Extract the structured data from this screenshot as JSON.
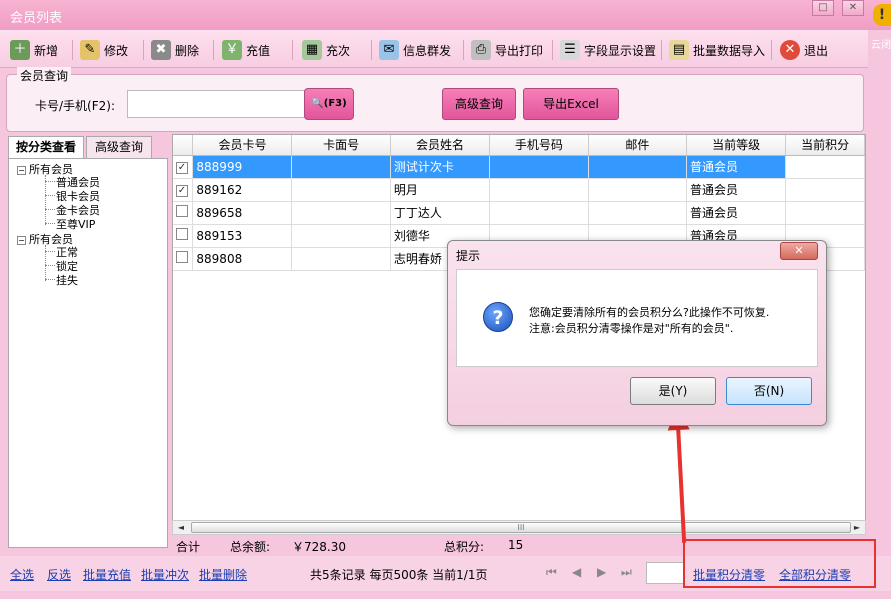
{
  "window": {
    "title": "会员列表",
    "min_glyph": "□",
    "close_glyph": "✕",
    "side_warn": "!",
    "side_text": "云闭"
  },
  "toolbar": [
    {
      "label": "新增",
      "icon": "add-member-icon"
    },
    {
      "label": "修改",
      "icon": "edit-icon"
    },
    {
      "label": "删除",
      "icon": "delete-icon"
    },
    {
      "label": "充值",
      "icon": "recharge-icon"
    },
    {
      "label": "充次",
      "icon": "recharge-count-icon"
    },
    {
      "label": "信息群发",
      "icon": "message-icon"
    },
    {
      "label": "导出打印",
      "icon": "printer-icon"
    },
    {
      "label": "字段显示设置",
      "icon": "field-settings-icon"
    },
    {
      "label": "批量数据导入",
      "icon": "import-icon"
    },
    {
      "label": "退出",
      "icon": "exit-icon"
    }
  ],
  "query": {
    "legend": "会员查询",
    "card_label": "卡号/手机(F2):",
    "card_value": "",
    "f3_label": "(F3)",
    "advanced_label": "高级查询",
    "export_label": "导出Excel"
  },
  "left_tabs": [
    "按分类查看",
    "高级查询"
  ],
  "tree": {
    "root1": "所有会员",
    "levels": [
      "普通会员",
      "银卡会员",
      "金卡会员",
      "至尊VIP"
    ],
    "root2": "所有会员",
    "statuses": [
      "正常",
      "锁定",
      "挂失"
    ]
  },
  "grid": {
    "columns": [
      "会员卡号",
      "卡面号",
      "会员姓名",
      "手机号码",
      "邮件",
      "当前等级",
      "当前积分"
    ],
    "rows": [
      {
        "checked": true,
        "card": "888999",
        "face": "",
        "name": "测试计次卡",
        "phone": "",
        "email": "",
        "level": "普通会员",
        "points": "",
        "selected": true
      },
      {
        "checked": true,
        "card": "889162",
        "face": "",
        "name": "明月",
        "phone": "",
        "email": "",
        "level": "普通会员",
        "points": "",
        "selected": false
      },
      {
        "checked": false,
        "card": "889658",
        "face": "",
        "name": "丁丁达人",
        "phone": "",
        "email": "",
        "level": "普通会员",
        "points": "",
        "selected": false
      },
      {
        "checked": false,
        "card": "889153",
        "face": "",
        "name": "刘德华",
        "phone": "",
        "email": "",
        "level": "普通会员",
        "points": "",
        "selected": false
      },
      {
        "checked": false,
        "card": "889808",
        "face": "",
        "name": "志明春娇",
        "phone": "",
        "email": "",
        "level": "",
        "points": "",
        "selected": false
      }
    ],
    "check_glyph": "✓",
    "scroll_thumb": "III",
    "scroll_left": "◄",
    "scroll_right": "►"
  },
  "summary": {
    "total_label": "合计",
    "balance_label": "总余额:",
    "balance_value": "￥728.30",
    "points_label": "总积分:",
    "points_value": "15"
  },
  "bottom": {
    "links_left": [
      "全选",
      "反选",
      "批量充值",
      "批量冲次",
      "批量删除"
    ],
    "page_info": "共5条记录  每页500条  当前1/1页",
    "nav": [
      "⏮",
      "◀",
      "▶",
      "⏭"
    ],
    "links_right": [
      "批量积分清零",
      "全部积分清零"
    ]
  },
  "dialog": {
    "title": "提示",
    "close_glyph": "✕",
    "icon_glyph": "?",
    "line1": "您确定要清除所有的会员积分么?此操作不可恢复.",
    "line2": "注意:会员积分清零操作是对\"所有的会员\".",
    "yes_label": "是(Y)",
    "no_label": "否(N)"
  }
}
